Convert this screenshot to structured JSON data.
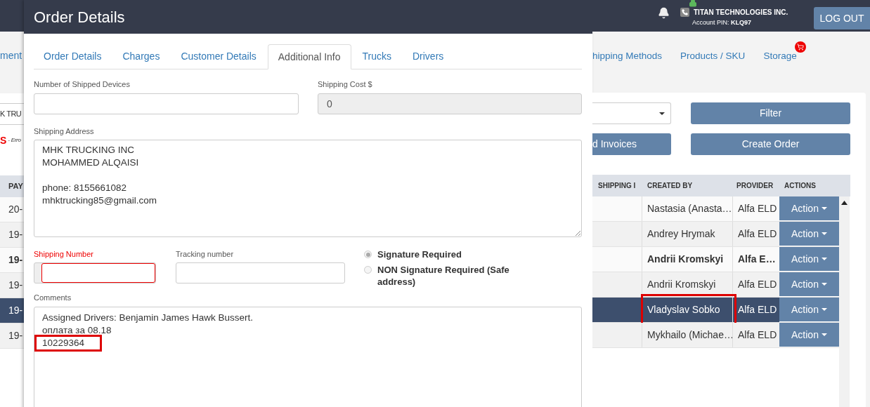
{
  "header": {
    "company": "TITAN TECHNOLOGIES INC.",
    "pin_label": "Account PIN:",
    "pin": "KLQ97",
    "logout": "LOG OUT"
  },
  "nav": {
    "left_fragment": "ment",
    "items": [
      {
        "label": "hipping Methods",
        "badge": false
      },
      {
        "label": "Products / SKU",
        "badge": false
      },
      {
        "label": "Storage",
        "badge": true
      }
    ]
  },
  "filter_panel": {
    "search_fragment": "K TRU",
    "error_mark": "S",
    "error_fragment": "- Erro",
    "filter_button": "Filter",
    "invoices_button": "d Invoices",
    "create_button": "Create Order"
  },
  "table": {
    "left_column": "PAY",
    "columns": [
      "SHIPPING I",
      "CREATED BY",
      "PROVIDER",
      "ACTIONS"
    ],
    "rows": [
      {
        "date": "20-",
        "created_by": "Nastasia (Anasta…",
        "provider": "Alfa ELD",
        "action": "Action",
        "bold": false,
        "selected": false,
        "highlighted": false
      },
      {
        "date": "19-",
        "created_by": "Andrey Hrymak",
        "provider": "Alfa ELD",
        "action": "Action",
        "bold": false,
        "selected": false,
        "highlighted": false
      },
      {
        "date": "19-",
        "created_by": "Andrii Kromskyi",
        "provider": "Alfa E…",
        "action": "Action",
        "bold": true,
        "selected": false,
        "highlighted": false
      },
      {
        "date": "19-",
        "created_by": "Andrii Kromskyi",
        "provider": "Alfa ELD",
        "action": "Action",
        "bold": false,
        "selected": false,
        "highlighted": false
      },
      {
        "date": "19-",
        "created_by": "Vladyslav Sobko",
        "provider": "Alfa ELD",
        "action": "Action",
        "bold": false,
        "selected": true,
        "highlighted": true
      },
      {
        "date": "19-",
        "created_by": "Mykhailo (Michae…",
        "provider": "Alfa ELD",
        "action": "Action",
        "bold": false,
        "selected": false,
        "highlighted": false
      }
    ]
  },
  "modal": {
    "title": "Order Details",
    "tabs": [
      {
        "label": "Order Details",
        "selected": false
      },
      {
        "label": "Charges",
        "selected": false
      },
      {
        "label": "Customer Details",
        "selected": false
      },
      {
        "label": "Additional Info",
        "selected": true
      },
      {
        "label": "Trucks",
        "selected": false
      },
      {
        "label": "Drivers",
        "selected": false
      }
    ],
    "devices": {
      "label": "Number of Shipped Devices"
    },
    "cost": {
      "label": "Shipping Cost $",
      "value": "0",
      "disabled": true
    },
    "address": {
      "label": "Shipping Address",
      "blocks": [
        [
          "MHK TRUCKING INC",
          "MOHAMMED ALQAISI"
        ],
        [
          "phone: 8155661082",
          "mhktrucking85@gmail.com"
        ]
      ]
    },
    "shipping_number": {
      "label": "Shipping Number",
      "error": true
    },
    "tracking": {
      "label": "Tracking number"
    },
    "signature_options": [
      {
        "label": "Signature Required",
        "selected": true
      },
      {
        "label": "NON Signature Required (Safe address)",
        "selected": false
      }
    ],
    "comments": {
      "label": "Comments",
      "lines": [
        {
          "text": "Assigned Drivers: Benjamin James Hawk Bussert.",
          "highlighted": false
        },
        {
          "text": "оплата за 08.18",
          "highlighted": false
        },
        {
          "text": "10229364",
          "highlighted": true
        }
      ]
    }
  }
}
